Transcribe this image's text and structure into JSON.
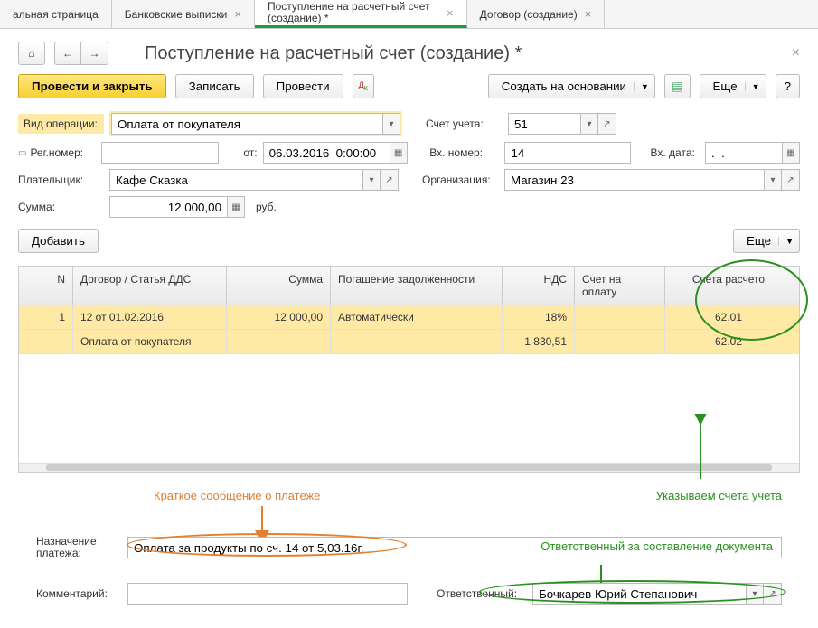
{
  "tabs": [
    {
      "label": "альная страница"
    },
    {
      "label": "Банковские выписки"
    },
    {
      "label": "Поступление на расчетный счет (создание) *",
      "active": true
    },
    {
      "label": "Договор (создание)"
    }
  ],
  "page_title": "Поступление на расчетный счет (создание) *",
  "toolbar": {
    "post_close": "Провести и закрыть",
    "save": "Записать",
    "post": "Провести",
    "create_based": "Создать на основании",
    "more": "Еще"
  },
  "fields": {
    "op_type_lbl": "Вид операции:",
    "op_type_val": "Оплата от покупателя",
    "account_lbl": "Счет учета:",
    "account_val": "51",
    "reg_lbl": "Рег.номер:",
    "reg_val": "",
    "from_lbl": "от:",
    "date_val": "06.03.2016  0:00:00",
    "ext_num_lbl": "Вх. номер:",
    "ext_num_val": "14",
    "ext_date_lbl": "Вх. дата:",
    "ext_date_val": ".  .",
    "payer_lbl": "Плательщик:",
    "payer_val": "Кафе Сказка",
    "org_lbl": "Организация:",
    "org_val": "Магазин 23",
    "sum_lbl": "Сумма:",
    "sum_val": "12 000,00",
    "sum_cur": "руб.",
    "add_btn": "Добавить",
    "purpose_lbl": "Назначение платежа:",
    "purpose_val": "Оплата за продукты по сч. 14 от 5,03.16г.",
    "comment_lbl": "Комментарий:",
    "comment_val": "",
    "responsible_lbl": "Ответственный:",
    "responsible_val": "Бочкарев Юрий Степанович"
  },
  "table": {
    "headers": {
      "n": "N",
      "dog": "Договор / Статья ДДС",
      "sum": "Сумма",
      "pog": "Погашение задолженности",
      "nds": "НДС",
      "inv": "Счет на оплату",
      "acc": "Счета расчето"
    },
    "rows": [
      {
        "n": "1",
        "dog": "12 от 01.02.2016",
        "sum": "12 000,00",
        "pog": "Автоматически",
        "nds": "18%",
        "inv": "",
        "acc": "62.01"
      },
      {
        "n": "",
        "dog": "Оплата от покупателя",
        "sum": "",
        "pog": "",
        "nds": "1 830,51",
        "inv": "",
        "acc": "62.02"
      }
    ]
  },
  "annotations": {
    "orange_text": "Краткое сообщение о платеже",
    "green_text1": "Указываем счета учета",
    "green_text2": "Ответственный за составление документа"
  }
}
